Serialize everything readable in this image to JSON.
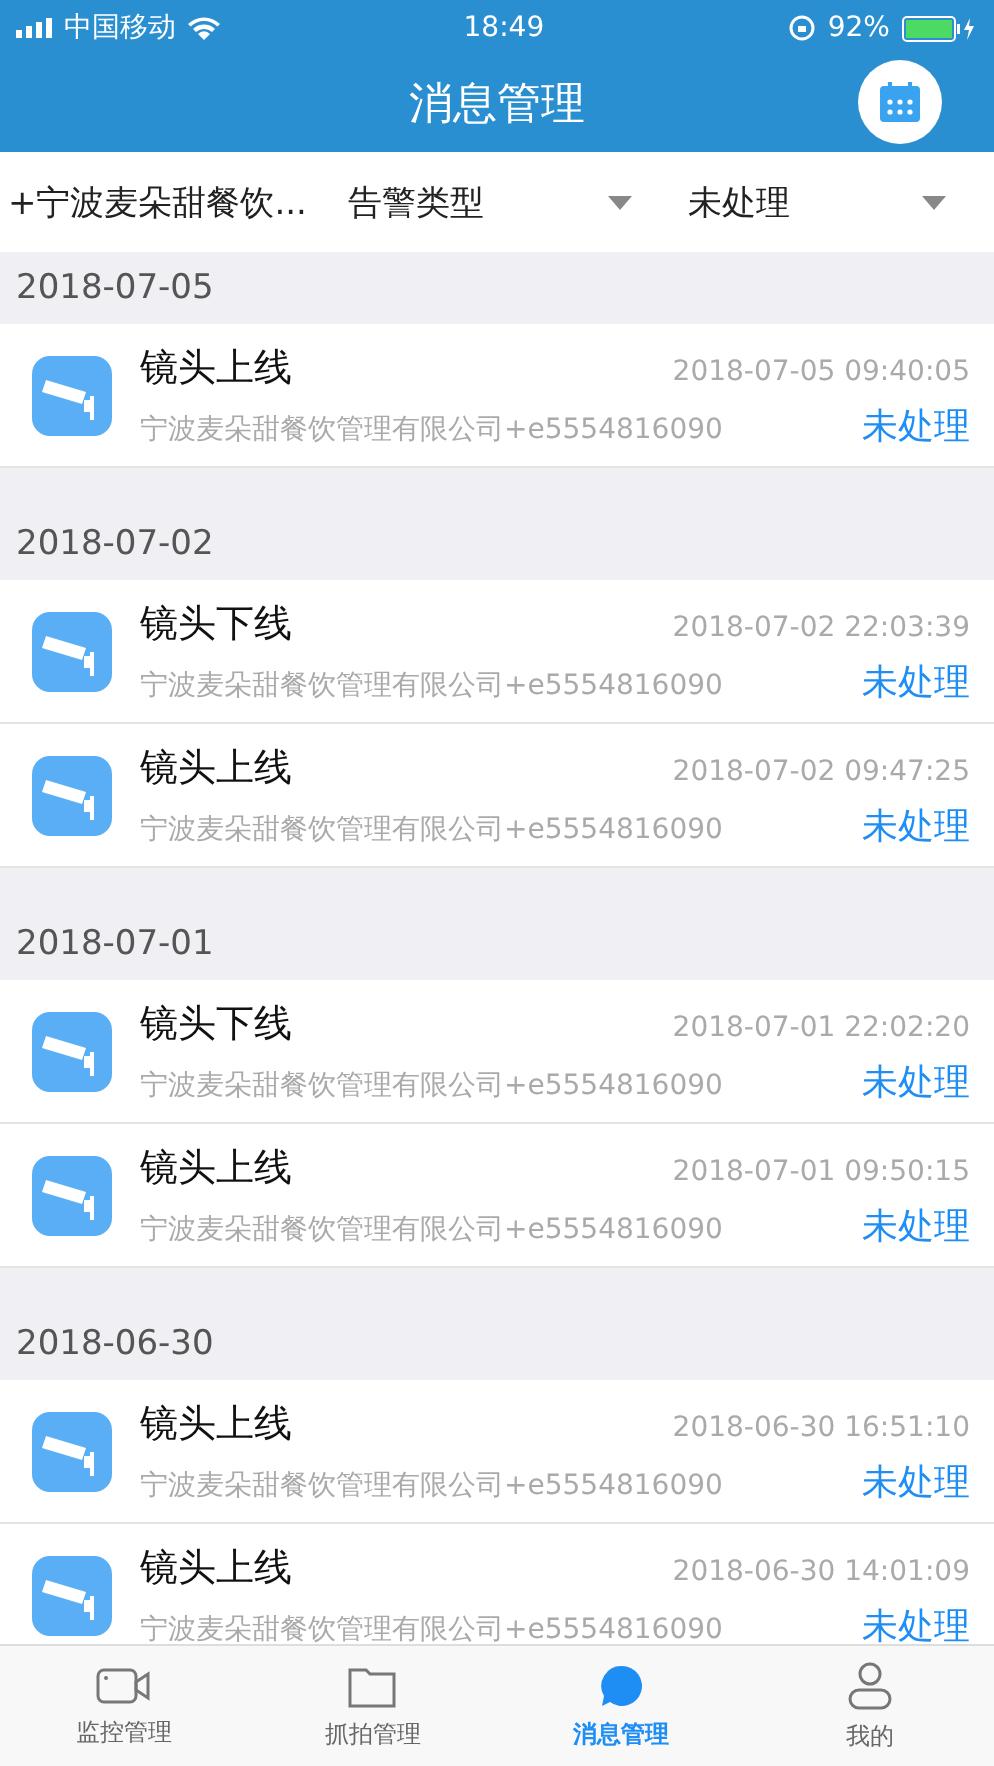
{
  "status_bar": {
    "carrier": "中国移动",
    "time": "18:49",
    "battery": "92%"
  },
  "header": {
    "title": "消息管理"
  },
  "filters": [
    {
      "label": "+宁波麦朵甜餐饮...",
      "has_caret": false
    },
    {
      "label": "告警类型",
      "has_caret": true
    },
    {
      "label": "未处理",
      "has_caret": true
    }
  ],
  "groups": [
    {
      "date": "2018-07-05",
      "items": [
        {
          "title": "镜头上线",
          "time": "2018-07-05 09:40:05",
          "source": "宁波麦朵甜餐饮管理有限公司+e5554816090",
          "status": "未处理"
        }
      ]
    },
    {
      "date": "2018-07-02",
      "items": [
        {
          "title": "镜头下线",
          "time": "2018-07-02 22:03:39",
          "source": "宁波麦朵甜餐饮管理有限公司+e5554816090",
          "status": "未处理"
        },
        {
          "title": "镜头上线",
          "time": "2018-07-02 09:47:25",
          "source": "宁波麦朵甜餐饮管理有限公司+e5554816090",
          "status": "未处理"
        }
      ]
    },
    {
      "date": "2018-07-01",
      "items": [
        {
          "title": "镜头下线",
          "time": "2018-07-01 22:02:20",
          "source": "宁波麦朵甜餐饮管理有限公司+e5554816090",
          "status": "未处理"
        },
        {
          "title": "镜头上线",
          "time": "2018-07-01 09:50:15",
          "source": "宁波麦朵甜餐饮管理有限公司+e5554816090",
          "status": "未处理"
        }
      ]
    },
    {
      "date": "2018-06-30",
      "items": [
        {
          "title": "镜头上线",
          "time": "2018-06-30 16:51:10",
          "source": "宁波麦朵甜餐饮管理有限公司+e5554816090",
          "status": "未处理"
        },
        {
          "title": "镜头上线",
          "time": "2018-06-30 14:01:09",
          "source": "宁波麦朵甜餐饮管理有限公司+e5554816090",
          "status": "未处理"
        }
      ]
    }
  ],
  "tabs": [
    {
      "label": "监控管理",
      "kind": "camera",
      "selected": false
    },
    {
      "label": "抓拍管理",
      "kind": "folder",
      "selected": false
    },
    {
      "label": "消息管理",
      "kind": "message",
      "selected": true
    },
    {
      "label": "我的",
      "kind": "user",
      "selected": false
    }
  ]
}
